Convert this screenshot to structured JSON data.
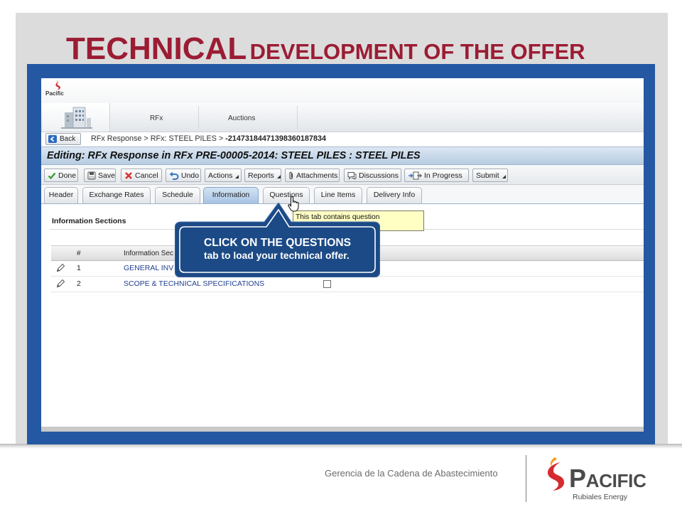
{
  "slide": {
    "title_main": "TECHNICAL",
    "title_rest": "DEVELOPMENT OF THE OFFER",
    "footer_text": "Gerencia de la Cadena de Abastecimiento"
  },
  "brand_logo": {
    "name": "PACIFIC",
    "tagline": "Rubiales Energy",
    "icon": "pacific-flame-icon"
  },
  "app": {
    "header_logo": {
      "name": "Pacific",
      "icon": "pacific-flame-icon"
    },
    "nav": {
      "home_icon": "building-icon",
      "tabs": [
        {
          "label": "RFx"
        },
        {
          "label": "Auctions"
        }
      ]
    },
    "breadcrumb": {
      "back_label": "Back",
      "back_icon": "back-arrow-icon",
      "separator": ">",
      "items": [
        "RFx Response",
        "RFx: STEEL PILES"
      ],
      "current": "-21473184471398360187834"
    },
    "page_title": "Editing: RFx Response in RFx PRE-00005-2014: STEEL PILES : STEEL PILES",
    "toolbar": [
      {
        "label": "Done",
        "icon": "check-icon"
      },
      {
        "label": "Save",
        "icon": "save-icon"
      },
      {
        "label": "Cancel",
        "icon": "cancel-icon"
      },
      {
        "label": "Undo",
        "icon": "undo-icon"
      },
      {
        "label": "Actions",
        "icon": "chevron-down-icon"
      },
      {
        "label": "Reports",
        "icon": "chevron-down-icon"
      },
      {
        "label": "Attachments",
        "icon": "paperclip-icon"
      },
      {
        "label": "Discussions",
        "icon": "discussion-icon"
      },
      {
        "label": "In Progress",
        "icon": "status-icon"
      },
      {
        "label": "Submit",
        "icon": "chevron-down-icon"
      }
    ],
    "tabs": [
      {
        "label": "Header"
      },
      {
        "label": "Exchange Rates"
      },
      {
        "label": "Schedule"
      },
      {
        "label": "Information",
        "active": true
      },
      {
        "label": "Questions"
      },
      {
        "label": "Line Items"
      },
      {
        "label": "Delivery Info"
      }
    ],
    "section_title": "Information Sections",
    "table": {
      "columns": [
        "#",
        "Information Sec"
      ],
      "rows": [
        {
          "num": "1",
          "name": "GENERAL INV"
        },
        {
          "num": "2",
          "name": "SCOPE & TECHNICAL SPECIFICATIONS",
          "checked": false
        }
      ]
    },
    "tooltip": "This tab contains question",
    "callout": {
      "line1": "CLICK ON THE QUESTIONS",
      "line2": "tab to load your technical offer."
    }
  },
  "colors": {
    "title_red": "#9b1c33",
    "frame_blue": "#2458a2",
    "callout_blue": "#1c4a86",
    "link_blue": "#1f3f8f",
    "tooltip_yellow": "#ffffc4",
    "active_tab_blue": "#a6c3e5"
  }
}
